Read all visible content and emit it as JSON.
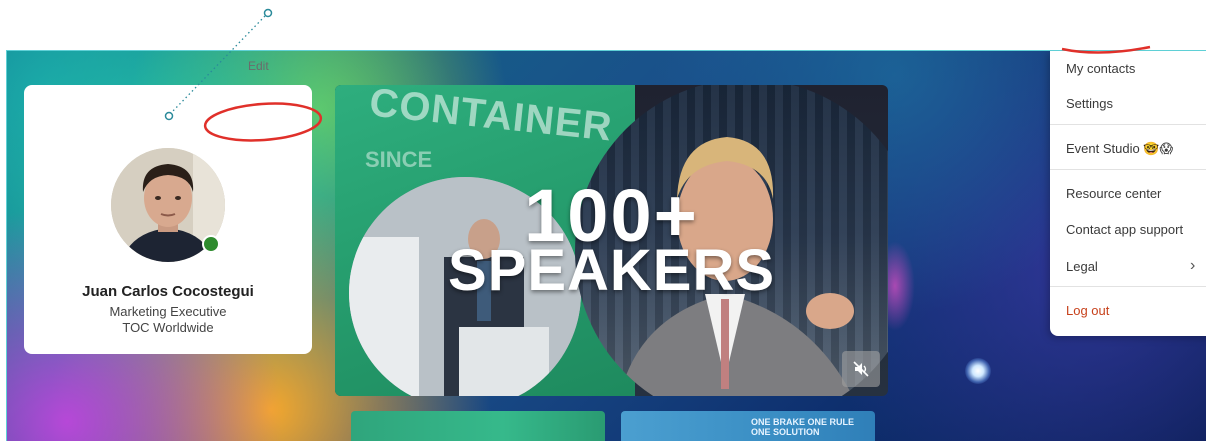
{
  "profile": {
    "edit_label": "Edit",
    "name": "Juan Carlos Cocostegui",
    "role": "Marketing Executive",
    "company": "TOC Worldwide",
    "status": "online"
  },
  "hero": {
    "wordmark": "CONTAINER",
    "sub": "SINCE",
    "title_line1": "100+",
    "title_line2": "SPEAKERS"
  },
  "thumbnails": {
    "second_caption": "ONE BRAKE ONE RULE ONE SOLUTION"
  },
  "menu": {
    "items": [
      {
        "label": "My contacts"
      },
      {
        "label": "Settings"
      },
      {
        "label": "Event Studio",
        "emoji": "🤓😱"
      },
      {
        "label": "Resource center"
      },
      {
        "label": "Contact app support"
      },
      {
        "label": "Legal"
      },
      {
        "label": "Log out"
      }
    ]
  },
  "colors": {
    "frame_border": "#5fd0d6",
    "annotation": "#2a8a9a",
    "highlight": "#e0302a",
    "logout": "#c7411b",
    "status_online": "#2e8b2e"
  }
}
